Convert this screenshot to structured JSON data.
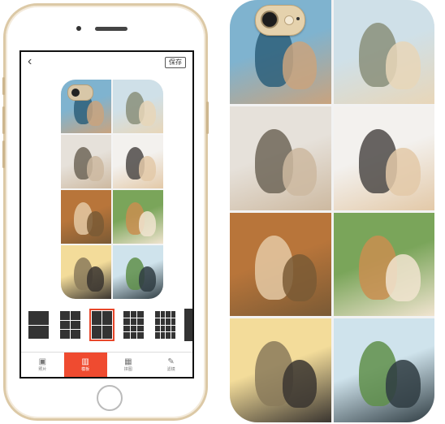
{
  "app": {
    "save_label": "保存",
    "back_icon": "chevron-left-icon",
    "accent": "#ef4b30"
  },
  "tabs": [
    {
      "label": "照片",
      "icon": "image-icon",
      "active": false
    },
    {
      "label": "模板",
      "icon": "layout-icon",
      "active": true
    },
    {
      "label": "拼图",
      "icon": "collage-icon",
      "active": false
    },
    {
      "label": "滤镜",
      "icon": "brush-icon",
      "active": false
    }
  ],
  "layouts": [
    {
      "name": "2x2",
      "selected": false
    },
    {
      "name": "3x3",
      "selected": false
    },
    {
      "name": "2x4",
      "selected": true
    },
    {
      "name": "3x4",
      "selected": false
    },
    {
      "name": "4x4",
      "selected": false
    }
  ],
  "photos": [
    {
      "name": "beach-woman-photo",
      "colors": [
        "#7fb3cf",
        "#2d5f7a",
        "#c9a37e"
      ]
    },
    {
      "name": "paris-woman-photo",
      "colors": [
        "#cfe0e8",
        "#8a8f7a",
        "#e8d6b8"
      ]
    },
    {
      "name": "father-baby-photo",
      "colors": [
        "#e6e1da",
        "#6f6658",
        "#cdb9a0"
      ]
    },
    {
      "name": "mother-baby-bed-photo",
      "colors": [
        "#f3f1ee",
        "#4d4a48",
        "#e3c9a8"
      ]
    },
    {
      "name": "golden-retriever-photo",
      "colors": [
        "#b8753a",
        "#e4c9a4",
        "#7a5a35"
      ]
    },
    {
      "name": "baby-dog-grass-photo",
      "colors": [
        "#7aa55a",
        "#c98e50",
        "#f1e4d0"
      ]
    },
    {
      "name": "couple-city-sunset-photo",
      "colors": [
        "#f3dc9a",
        "#8a7a5a",
        "#3a3530"
      ]
    },
    {
      "name": "family-park-photo",
      "colors": [
        "#cfe3ec",
        "#5f8f4a",
        "#2f3c42"
      ]
    }
  ]
}
